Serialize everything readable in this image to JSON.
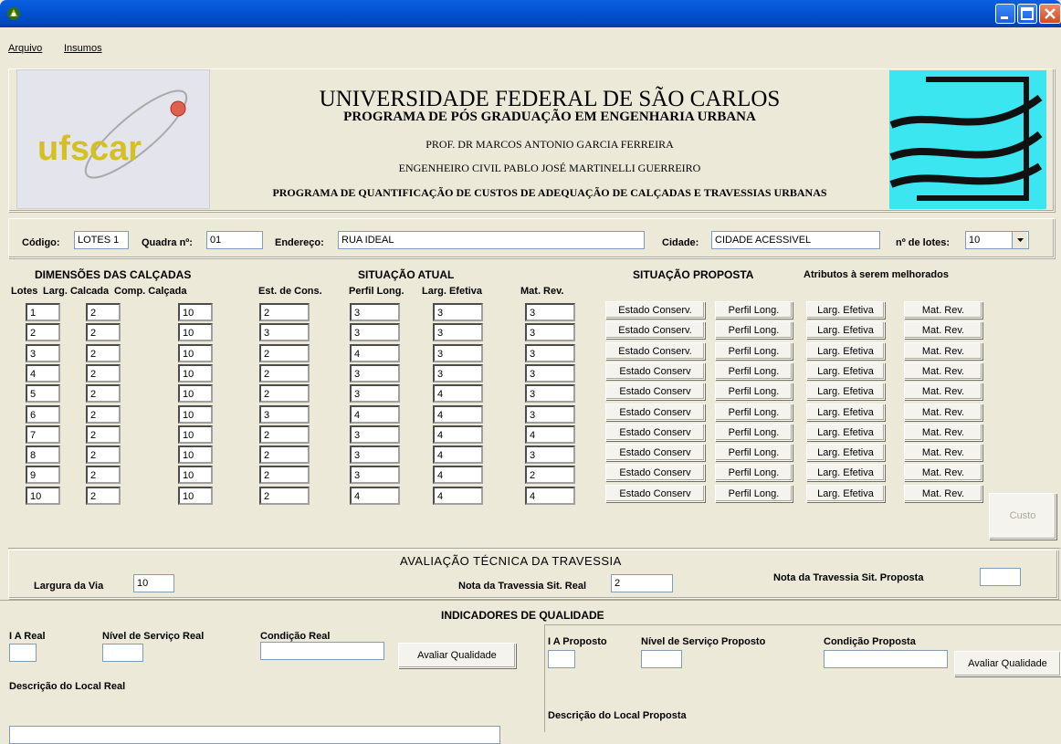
{
  "window": {
    "app_icon": "leaf-icon",
    "buttons": [
      "minimize-icon",
      "maximize-icon",
      "close-icon"
    ]
  },
  "menu": {
    "items": [
      "Arquivo",
      "Insumos"
    ]
  },
  "header": {
    "left_logo_text": "ufscar",
    "line1": "UNIVERSIDADE FEDERAL DE SÃO  CARLOS",
    "line2": "PROGRAMA DE PÓS GRADUAÇÃO EM ENGENHARIA URBANA",
    "line3": "PROF. DR MARCOS ANTONIO GARCIA FERREIRA",
    "line4": "ENGENHEIRO CIVIL PABLO JOSÉ MARTINELLI GUERREIRO",
    "line5": "PROGRAMA DE QUANTIFICAÇÃO DE CUSTOS DE ADEQUAÇÃO DE CALÇADAS E TRAVESSIAS URBANAS"
  },
  "info": {
    "codigo_label": "Código:",
    "codigo_value": "LOTES 1",
    "quadra_label": "Quadra nº:",
    "quadra_value": "01",
    "endereco_label": "Endereço:",
    "endereco_value": "RUA IDEAL",
    "cidade_label": "Cidade:",
    "cidade_value": "CIDADE ACESSIVEL",
    "lotes_label": "nº de lotes:",
    "lotes_value": "10"
  },
  "sections": {
    "dimensoes": "DIMENSÕES DAS CALÇADAS",
    "situacao_atual": "SITUAÇÃO ATUAL",
    "situacao_proposta": "SITUAÇÃO PROPOSTA",
    "atributos": "Atributos à serem melhorados"
  },
  "columns": {
    "lotes": "Lotes",
    "larg": "Larg. Calcada",
    "comp": "Comp. Calçada",
    "est": "Est. de Cons.",
    "perfil": "Perfil Long.",
    "efetiva": "Larg. Efetiva",
    "mat": "Mat. Rev."
  },
  "rows": [
    {
      "lote": "1",
      "larg": "2",
      "comp": "10",
      "est": "2",
      "perfil": "3",
      "efetiva": "3",
      "mat": "3",
      "btn_est": "Estado Conserv.",
      "btn_perfil": "Perfil Long.",
      "btn_larg": "Larg. Efetiva",
      "btn_mat": "Mat. Rev."
    },
    {
      "lote": "2",
      "larg": "2",
      "comp": "10",
      "est": "3",
      "perfil": "3",
      "efetiva": "3",
      "mat": "3",
      "btn_est": "Estado Conserv.",
      "btn_perfil": "Perfil Long.",
      "btn_larg": "Larg. Efetiva",
      "btn_mat": "Mat. Rev."
    },
    {
      "lote": "3",
      "larg": "2",
      "comp": "10",
      "est": "2",
      "perfil": "4",
      "efetiva": "3",
      "mat": "3",
      "btn_est": "Estado Conserv.",
      "btn_perfil": "Perfil Long.",
      "btn_larg": "Larg. Efetiva",
      "btn_mat": "Mat. Rev."
    },
    {
      "lote": "4",
      "larg": "2",
      "comp": "10",
      "est": "2",
      "perfil": "3",
      "efetiva": "3",
      "mat": "3",
      "btn_est": "Estado Conserv",
      "btn_perfil": "Perfil Long.",
      "btn_larg": "Larg. Efetiva",
      "btn_mat": "Mat. Rev."
    },
    {
      "lote": "5",
      "larg": "2",
      "comp": "10",
      "est": "2",
      "perfil": "3",
      "efetiva": "4",
      "mat": "3",
      "btn_est": "Estado Conserv",
      "btn_perfil": "Perfil Long.",
      "btn_larg": "Larg. Efetiva",
      "btn_mat": "Mat. Rev."
    },
    {
      "lote": "6",
      "larg": "2",
      "comp": "10",
      "est": "3",
      "perfil": "4",
      "efetiva": "4",
      "mat": "3",
      "btn_est": "Estado Conserv",
      "btn_perfil": "Perfil Long.",
      "btn_larg": "Larg. Efetiva",
      "btn_mat": "Mat. Rev."
    },
    {
      "lote": "7",
      "larg": "2",
      "comp": "10",
      "est": "2",
      "perfil": "3",
      "efetiva": "4",
      "mat": "4",
      "btn_est": "Estado Conserv",
      "btn_perfil": "Perfil Long.",
      "btn_larg": "Larg. Efetiva",
      "btn_mat": "Mat. Rev."
    },
    {
      "lote": "8",
      "larg": "2",
      "comp": "10",
      "est": "2",
      "perfil": "3",
      "efetiva": "4",
      "mat": "3",
      "btn_est": "Estado Conserv",
      "btn_perfil": "Perfil Long.",
      "btn_larg": "Larg. Efetiva",
      "btn_mat": "Mat. Rev."
    },
    {
      "lote": "9",
      "larg": "2",
      "comp": "10",
      "est": "2",
      "perfil": "3",
      "efetiva": "4",
      "mat": "2",
      "btn_est": "Estado Conserv",
      "btn_perfil": "Perfil Long.",
      "btn_larg": "Larg. Efetiva",
      "btn_mat": "Mat. Rev."
    },
    {
      "lote": "10",
      "larg": "2",
      "comp": "10",
      "est": "2",
      "perfil": "4",
      "efetiva": "4",
      "mat": "4",
      "btn_est": "Estado Conserv",
      "btn_perfil": "Perfil Long.",
      "btn_larg": "Larg. Efetiva",
      "btn_mat": "Mat. Rev."
    }
  ],
  "custo_button": "Custo",
  "travessia": {
    "title": "AVALIAÇÃO TÉCNICA DA TRAVESSIA",
    "largura_label": "Largura da Via",
    "largura_value": "10",
    "nota_real_label": "Nota da Travessia Sit. Real",
    "nota_real_value": "2",
    "nota_proposta_label": "Nota da Travessia Sit. Proposta",
    "nota_proposta_value": ""
  },
  "indicadores": {
    "title": "INDICADORES DE QUALIDADE",
    "ia_real_label": "I A Real",
    "nivel_real_label": "Nível de Serviço Real",
    "condicao_real_label": "Condição Real",
    "avaliar_real": "Avaliar Qualidade",
    "descricao_real_label": "Descrição do Local Real",
    "ia_proposto_label": "I A Proposto",
    "nivel_proposto_label": "Nível de Serviço  Proposto",
    "condicao_proposta_label": "Condição Proposta",
    "avaliar_proposta": "Avaliar Qualidade",
    "descricao_proposta_label": "Descrição do Local Proposta"
  }
}
